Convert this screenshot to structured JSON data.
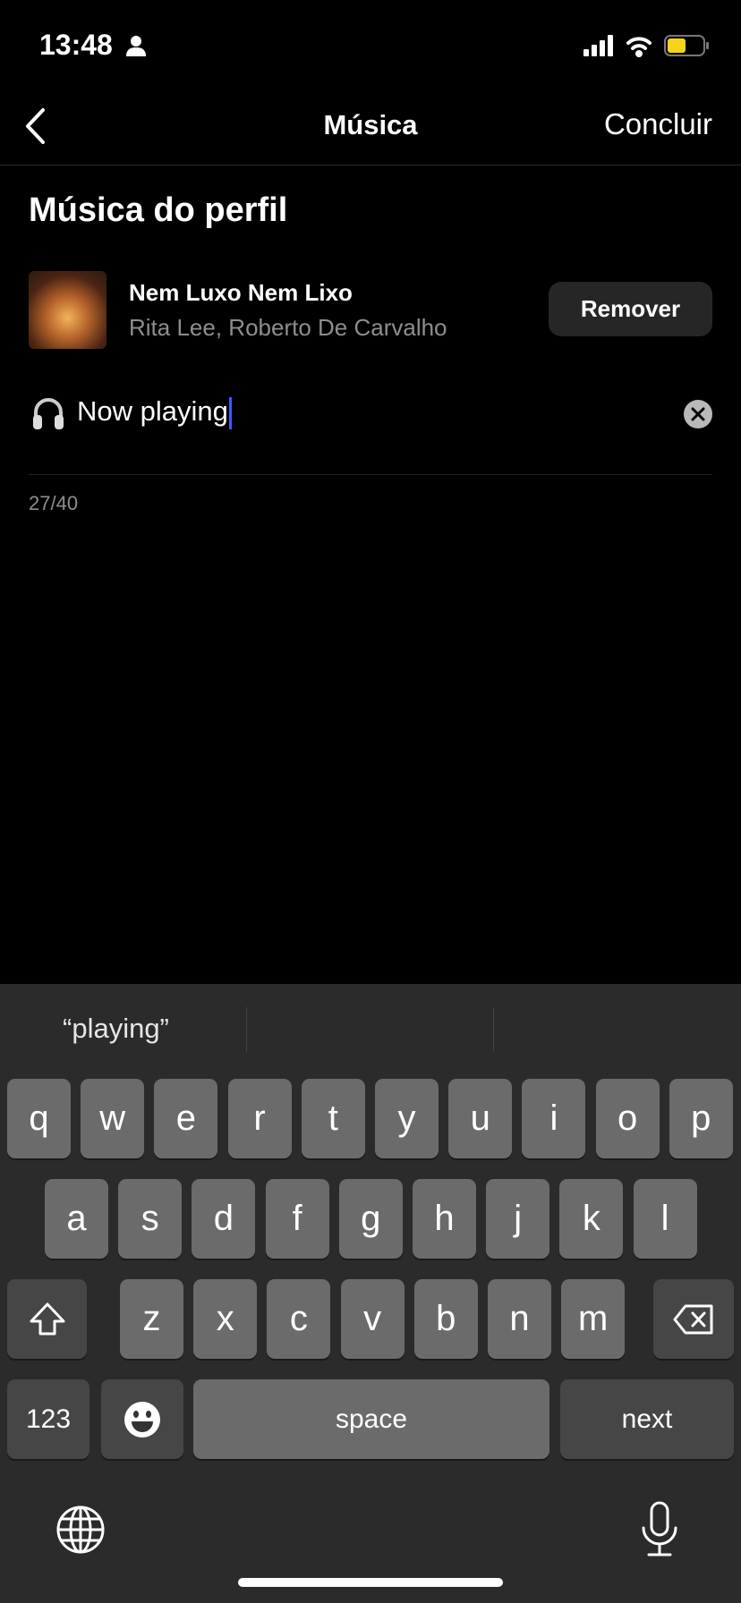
{
  "status": {
    "time": "13:48",
    "battery_color": "#f5d31c"
  },
  "nav": {
    "title": "Música",
    "done": "Concluir"
  },
  "section": {
    "heading": "Música do perfil"
  },
  "track": {
    "title": "Nem Luxo Nem Lixo",
    "artist": "Rita Lee, Roberto De Carvalho",
    "remove": "Remover"
  },
  "input": {
    "value": "Now playing",
    "counter": "27/40"
  },
  "keyboard": {
    "suggestion": "“playing”",
    "row1": [
      "q",
      "w",
      "e",
      "r",
      "t",
      "y",
      "u",
      "i",
      "o",
      "p"
    ],
    "row2": [
      "a",
      "s",
      "d",
      "f",
      "g",
      "h",
      "j",
      "k",
      "l"
    ],
    "row3": [
      "z",
      "x",
      "c",
      "v",
      "b",
      "n",
      "m"
    ],
    "numbers": "123",
    "space": "space",
    "next": "next"
  }
}
